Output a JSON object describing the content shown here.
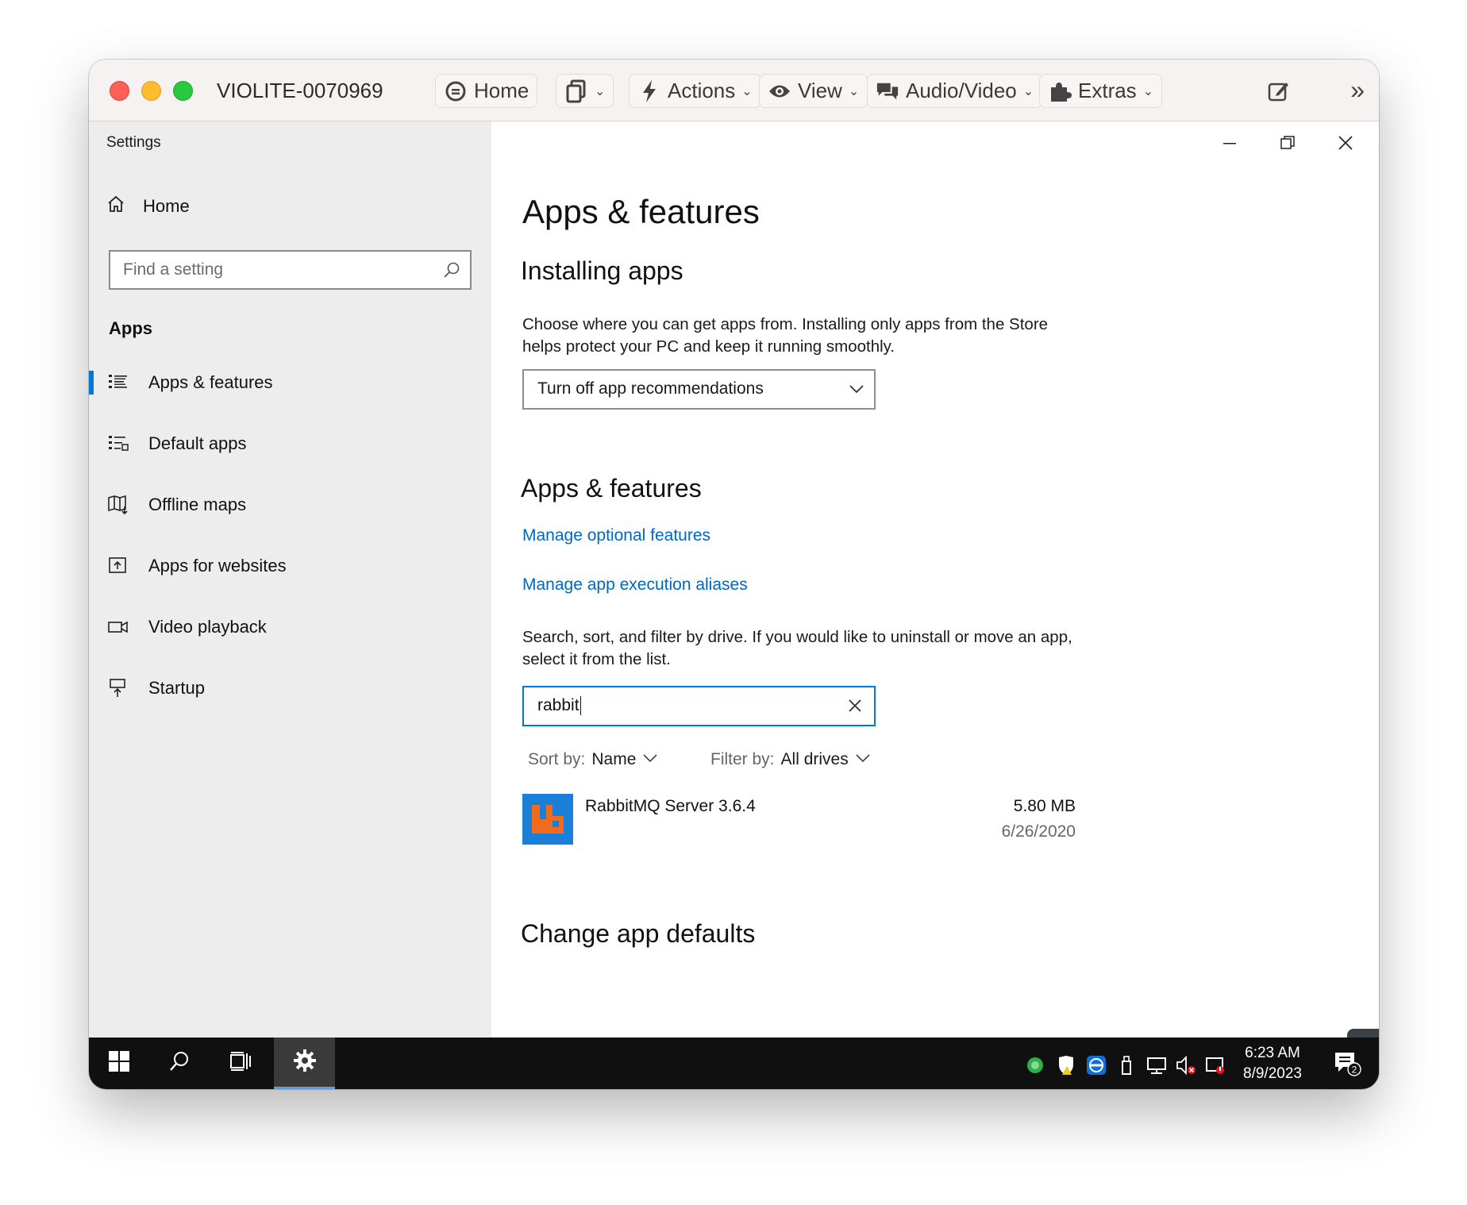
{
  "window": {
    "title": "VIOLITE-0070969",
    "toolbar": {
      "home_label": "Home",
      "actions_label": "Actions",
      "view_label": "View",
      "audio_video_label": "Audio/Video",
      "extras_label": "Extras"
    }
  },
  "settings": {
    "app_label": "Settings",
    "home_label": "Home",
    "search": {
      "placeholder": "Find a setting"
    },
    "section": "Apps",
    "nav": [
      {
        "label": "Apps & features",
        "icon": "list-icon",
        "active": true
      },
      {
        "label": "Default apps",
        "icon": "default-apps-icon",
        "active": false
      },
      {
        "label": "Offline maps",
        "icon": "map-icon",
        "active": false
      },
      {
        "label": "Apps for websites",
        "icon": "website-link-icon",
        "active": false
      },
      {
        "label": "Video playback",
        "icon": "video-icon",
        "active": false
      },
      {
        "label": "Startup",
        "icon": "startup-icon",
        "active": false
      }
    ]
  },
  "main": {
    "title": "Apps & features",
    "installing_heading": "Installing apps",
    "installing_text": "Choose where you can get apps from. Installing only apps from the Store helps protect your PC and keep it running smoothly.",
    "install_dropdown_value": "Turn off app recommendations",
    "features_heading": "Apps & features",
    "link_optional": "Manage optional features",
    "link_aliases": "Manage app execution aliases",
    "search_text": "Search, sort, and filter by drive. If you would like to uninstall or move an app, select it from the list.",
    "search_value": "rabbit",
    "sort_label": "Sort by:",
    "sort_value": "Name",
    "filter_label": "Filter by:",
    "filter_value": "All drives",
    "apps": [
      {
        "name": "RabbitMQ Server 3.6.4",
        "size": "5.80 MB",
        "date": "6/26/2020"
      }
    ],
    "change_defaults_heading": "Change app defaults"
  },
  "taskbar": {
    "time": "6:23 AM",
    "date": "8/9/2023",
    "notification_count": "2"
  },
  "colors": {
    "accent": "#0078d7",
    "link": "#0067c0",
    "rabbitmq_orange": "#f26b1d"
  }
}
